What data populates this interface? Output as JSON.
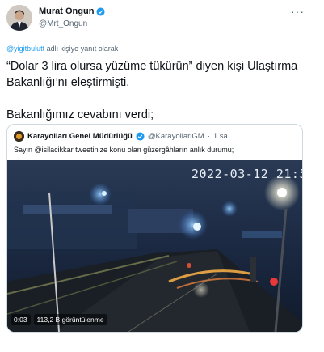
{
  "author": {
    "name": "Murat Ongun",
    "handle": "@Mrt_Ongun"
  },
  "more_menu": "···",
  "reply_context": {
    "mention": "@yigitbulutt",
    "suffix": " adlı kişiye yanıt olarak"
  },
  "tweet_text": {
    "paragraph1": "“Dolar 3 lira olursa yüzüme tükürün” diyen kişi Ulaştırma Bakanlığı’nı eleştirmişti.",
    "paragraph2": "Bakanlığımız cevabını verdi;"
  },
  "quoted": {
    "name": "Karayolları Genel Müdürlüğü",
    "handle": "@KarayollariGM",
    "separator": "·",
    "age": "1 sa",
    "text": "Sayın @isilacikkar tweetinize konu olan güzergâhların anlık durumu;"
  },
  "video": {
    "camera_timestamp": "2022-03-12 21:5",
    "elapsed": "0:03",
    "views": "113,2 B görüntülenme"
  },
  "colors": {
    "verified": "#1d9bf0",
    "mention": "#1d9bf0",
    "secondary_text": "#536471",
    "border": "#cfd9de"
  }
}
